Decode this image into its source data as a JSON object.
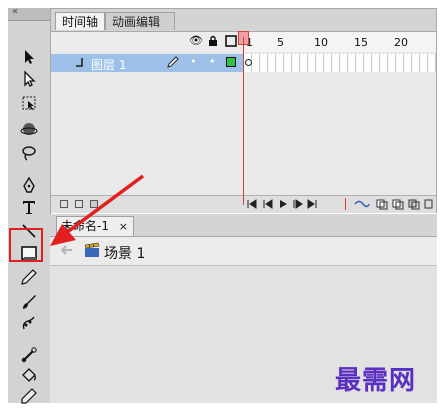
{
  "window": {
    "collapse_glyph": "«"
  },
  "panel_tabs": [
    {
      "label": "时间轴"
    },
    {
      "label": "动画编辑器"
    }
  ],
  "layer": {
    "name": "图层 1",
    "dots": [
      "•",
      "•"
    ]
  },
  "frame_ruler": {
    "labels": [
      "1",
      "5",
      "10",
      "15",
      "20"
    ]
  },
  "document": {
    "tab_label": "未命名-1",
    "close_glyph": "×"
  },
  "scene": {
    "label": "场景 1"
  },
  "watermark": {
    "text": "最需网"
  },
  "annotation": {
    "highlight_color": "#e32020",
    "arrow_color": "#e32020",
    "highlighted_tool": "rectangle-tool"
  },
  "icons": {
    "tools": [
      "selection-arrow-icon",
      "subselection-arrow-icon",
      "free-transform-icon",
      "3d-rotation-icon",
      "lasso-icon",
      "pen-icon",
      "text-tool-icon",
      "line-tool-icon",
      "rectangle-tool-icon",
      "pencil-icon",
      "brush-icon",
      "deco-icon",
      "bone-icon",
      "paint-bucket-icon",
      "eyedropper-icon"
    ],
    "layer_header": [
      "eye-icon",
      "lock-icon",
      "outline-icon"
    ]
  }
}
